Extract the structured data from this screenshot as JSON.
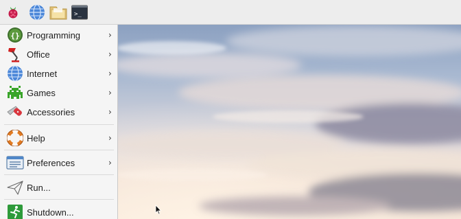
{
  "taskbar": {
    "buttons": [
      {
        "icon": "raspberry-pi-menu-icon"
      },
      {
        "icon": "web-browser-globe-icon"
      },
      {
        "icon": "file-manager-folder-icon"
      },
      {
        "icon": "terminal-icon",
        "glyph": ">_"
      }
    ]
  },
  "menu": {
    "items": [
      {
        "label": "Programming",
        "icon": "programming-icon",
        "has_submenu": true
      },
      {
        "label": "Office",
        "icon": "office-lamp-icon",
        "has_submenu": true
      },
      {
        "label": "Internet",
        "icon": "internet-globe-icon",
        "has_submenu": true
      },
      {
        "label": "Games",
        "icon": "games-invader-icon",
        "has_submenu": true
      },
      {
        "label": "Accessories",
        "icon": "accessories-knife-icon",
        "has_submenu": true
      },
      {
        "label": "Help",
        "icon": "help-lifebuoy-icon",
        "has_submenu": true
      },
      {
        "label": "Preferences",
        "icon": "preferences-icon",
        "has_submenu": true
      },
      {
        "label": "Run...",
        "icon": "run-paper-plane-icon",
        "has_submenu": false
      },
      {
        "label": "Shutdown...",
        "icon": "shutdown-running-man-icon",
        "has_submenu": false
      }
    ],
    "submenu_arrow": "›"
  },
  "colors": {
    "taskbar_bg": "#ededed",
    "menu_bg": "#f5f5f5",
    "text": "#1e1e1e"
  }
}
